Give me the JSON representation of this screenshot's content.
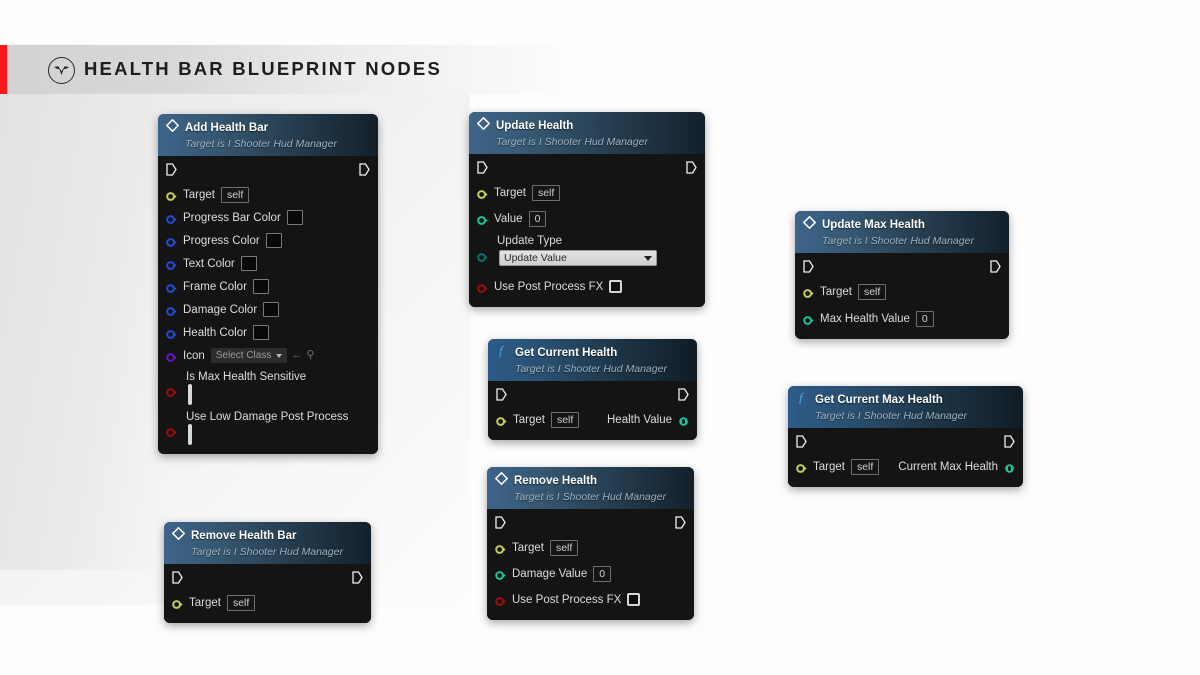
{
  "header": {
    "title": "HEALTH BAR BLUEPRINT NODES",
    "logo_icon": "winged-emblem-icon",
    "accent_color": "#fb1a1a"
  },
  "palette": {
    "exec_pin": "#ffffff",
    "object_pin": "#c6cf5a",
    "linear_color_pin": "#1f4fd8",
    "float_pin": "#19c79a",
    "bool_pin": "#a00b0b",
    "class_pin": "#6a12c9",
    "node_title_bar": "#3e648a",
    "node_body": "#141414"
  },
  "nodes": [
    {
      "id": "add-health-bar",
      "title": "Add Health Bar",
      "subtitle": "Target is I Shooter Hud Manager",
      "kind": "event",
      "icon": "blueprint-diamond-icon",
      "pins": [
        {
          "label": "Target",
          "type": "object",
          "control": "value",
          "value": "self"
        },
        {
          "label": "Progress Bar Color",
          "type": "linearcolor",
          "control": "swatch",
          "value": "#090909"
        },
        {
          "label": "Progress Color",
          "type": "linearcolor",
          "control": "swatch",
          "value": "#090909"
        },
        {
          "label": "Text Color",
          "type": "linearcolor",
          "control": "swatch",
          "value": "#090909"
        },
        {
          "label": "Frame Color",
          "type": "linearcolor",
          "control": "swatch",
          "value": "#090909"
        },
        {
          "label": "Damage Color",
          "type": "linearcolor",
          "control": "swatch",
          "value": "#090909"
        },
        {
          "label": "Health Color",
          "type": "linearcolor",
          "control": "swatch",
          "value": "#090909"
        },
        {
          "label": "Icon",
          "type": "class",
          "control": "classpicker",
          "value": "Select Class"
        },
        {
          "label": "Is Max Health Sensitive",
          "type": "bool",
          "control": "checkbox",
          "value": "unchecked",
          "stacked": true
        },
        {
          "label": "Use Low Damage Post Process",
          "type": "bool",
          "control": "checkbox",
          "value": "unchecked",
          "stacked": true
        }
      ]
    },
    {
      "id": "remove-health-bar",
      "title": "Remove Health Bar",
      "subtitle": "Target is I Shooter Hud Manager",
      "kind": "event",
      "icon": "blueprint-diamond-icon",
      "pins": [
        {
          "label": "Target",
          "type": "object",
          "control": "value",
          "value": "self"
        }
      ]
    },
    {
      "id": "update-health",
      "title": "Update Health",
      "subtitle": "Target is I Shooter Hud Manager",
      "kind": "event",
      "icon": "blueprint-diamond-icon",
      "pins": [
        {
          "label": "Target",
          "type": "object",
          "control": "value",
          "value": "self"
        },
        {
          "label": "Value",
          "type": "float",
          "control": "value",
          "value": "0"
        },
        {
          "label": "Update Type",
          "type": "enum",
          "control": "combo",
          "value": "Update Value",
          "stacked": true
        },
        {
          "label": "Use Post Process FX",
          "type": "bool",
          "control": "checkbox",
          "value": "unchecked"
        }
      ]
    },
    {
      "id": "get-current-health",
      "title": "Get Current Health",
      "subtitle": "Target is I Shooter Hud Manager",
      "kind": "function",
      "icon": "function-f-icon",
      "pins": [
        {
          "label": "Target",
          "type": "object",
          "control": "value",
          "value": "self"
        }
      ],
      "outputs": [
        {
          "label": "Health Value",
          "type": "float"
        }
      ]
    },
    {
      "id": "remove-health",
      "title": "Remove Health",
      "subtitle": "Target is I Shooter Hud Manager",
      "kind": "event",
      "icon": "blueprint-diamond-icon",
      "pins": [
        {
          "label": "Target",
          "type": "object",
          "control": "value",
          "value": "self"
        },
        {
          "label": "Damage Value",
          "type": "float",
          "control": "value",
          "value": "0"
        },
        {
          "label": "Use Post Process FX",
          "type": "bool",
          "control": "checkbox",
          "value": "unchecked"
        }
      ]
    },
    {
      "id": "update-max-health",
      "title": "Update Max Health",
      "subtitle": "Target is I Shooter Hud Manager",
      "kind": "event",
      "icon": "blueprint-diamond-icon",
      "pins": [
        {
          "label": "Target",
          "type": "object",
          "control": "value",
          "value": "self"
        },
        {
          "label": "Max Health Value",
          "type": "float",
          "control": "value",
          "value": "0"
        }
      ]
    },
    {
      "id": "get-current-max-health",
      "title": "Get Current Max Health",
      "subtitle": "Target is I Shooter Hud Manager",
      "kind": "function",
      "icon": "function-f-icon",
      "pins": [
        {
          "label": "Target",
          "type": "object",
          "control": "value",
          "value": "self"
        }
      ],
      "outputs": [
        {
          "label": "Current Max Health",
          "type": "float"
        }
      ]
    }
  ]
}
